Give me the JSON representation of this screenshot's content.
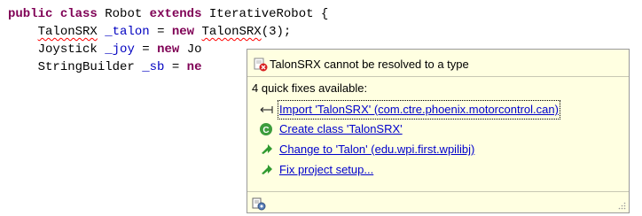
{
  "editor": {
    "line1": {
      "kw_public": "public",
      "kw_class": "class",
      "class_name": "Robot",
      "kw_extends": "extends",
      "super_name": "IterativeRobot",
      "brace": "{"
    },
    "line2": {
      "type": "TalonSRX",
      "var": "_talon",
      "eq": "=",
      "kw_new": "new",
      "ctor": "TalonSRX",
      "args": "(3);"
    },
    "line3": {
      "type": "Joystick",
      "var": "_joy",
      "eq": "=",
      "kw_new": "new",
      "ctor_partial": "Jo"
    },
    "line4": {
      "type": "StringBuilder",
      "var": "_sb",
      "eq": "=",
      "kw_new_partial": "ne"
    }
  },
  "quickfix": {
    "title": "TalonSRX cannot be resolved to a type",
    "count_label": "4 quick fixes available:",
    "fixes": [
      {
        "label": "Import 'TalonSRX' (com.ctre.phoenix.motorcontrol.can)",
        "icon": "import-icon",
        "selected": true
      },
      {
        "label": "Create class 'TalonSRX'",
        "icon": "create-class-icon"
      },
      {
        "label": "Change to 'Talon' (edu.wpi.first.wpilibj)",
        "icon": "change-icon"
      },
      {
        "label": "Fix project setup...",
        "icon": "change-icon"
      }
    ]
  },
  "colors": {
    "keyword": "#7f0055",
    "field": "#0000c0",
    "link": "#0000cc",
    "popup_bg": "#ffffe1",
    "error": "#ff0000"
  }
}
